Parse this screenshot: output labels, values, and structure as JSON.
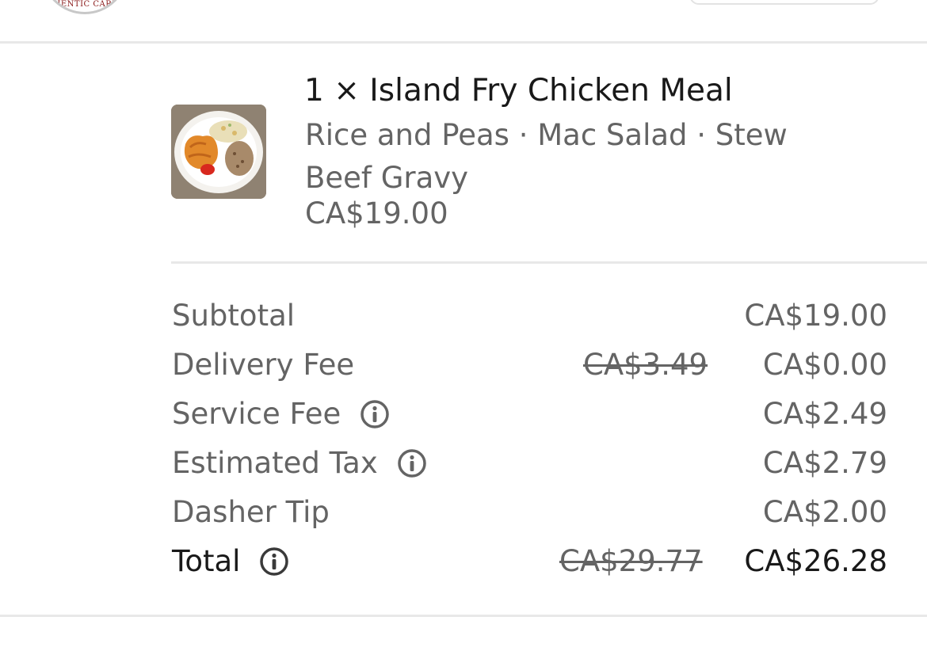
{
  "header": {
    "logo_text": "THENTIC CARIB"
  },
  "cart_item": {
    "title": "1 × Island Fry Chicken Meal",
    "options": "Rice and Peas · Mac Salad · Stew Beef Gravy",
    "price": "CA$19.00"
  },
  "summary": {
    "subtotal": {
      "label": "Subtotal",
      "value": "CA$19.00"
    },
    "delivery_fee": {
      "label": "Delivery Fee",
      "original": "CA$3.49",
      "value": "CA$0.00"
    },
    "service_fee": {
      "label": "Service Fee",
      "value": "CA$2.49"
    },
    "estimated_tax": {
      "label": "Estimated Tax",
      "value": "CA$2.79"
    },
    "dasher_tip": {
      "label": "Dasher Tip",
      "value": "CA$2.00"
    },
    "total": {
      "label": "Total",
      "original": "CA$29.77",
      "value": "CA$26.28"
    }
  },
  "icons": {
    "info": "info-circle-icon"
  }
}
